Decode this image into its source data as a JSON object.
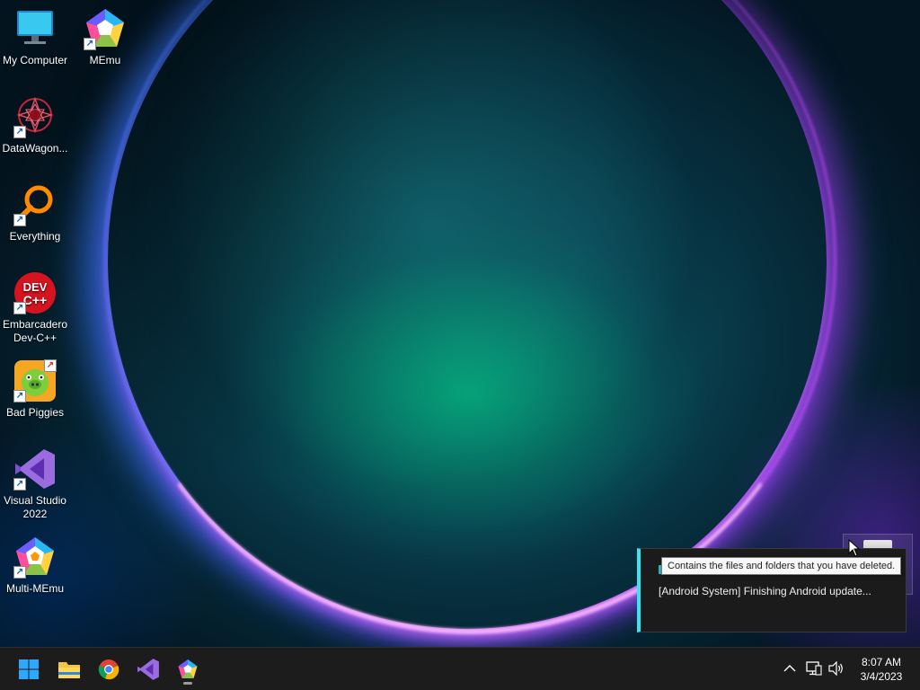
{
  "desktop": {
    "icons": [
      {
        "label": "My Computer",
        "icon": "computer-icon"
      },
      {
        "label": "MEmu",
        "icon": "memu-icon"
      },
      {
        "label": "DataWagon...",
        "icon": "datawagon-icon"
      },
      {
        "label": "Everything",
        "icon": "everything-search-icon"
      },
      {
        "label": "Embarcadero Dev-C++",
        "icon": "devcpp-icon"
      },
      {
        "label": "Bad Piggies",
        "icon": "bad-piggies-icon"
      },
      {
        "label": "Visual Studio 2022",
        "icon": "visual-studio-icon"
      },
      {
        "label": "Multi-MEmu",
        "icon": "multi-memu-icon"
      }
    ],
    "recycle_bin": {
      "icon": "recycle-bin-icon"
    },
    "tooltip": "Contains the files and folders that you have deleted."
  },
  "notification": {
    "message": "[Android System] Finishing Android update...",
    "accent": "#35e5f0"
  },
  "taskbar": {
    "apps": [
      {
        "name": "start",
        "icon": "windows-start-icon"
      },
      {
        "name": "file-explorer",
        "icon": "folder-icon"
      },
      {
        "name": "chrome",
        "icon": "chrome-icon"
      },
      {
        "name": "visual-studio",
        "icon": "visual-studio-icon"
      },
      {
        "name": "memu",
        "icon": "memu-icon",
        "running": true
      }
    ],
    "tray": [
      "chevron-up-icon",
      "network-icon",
      "volume-icon"
    ],
    "clock": {
      "time": "8:07 AM",
      "date": "3/4/2023"
    }
  },
  "colors": {
    "taskbar": "#1c1c1c",
    "accent": "#35e5f0"
  }
}
